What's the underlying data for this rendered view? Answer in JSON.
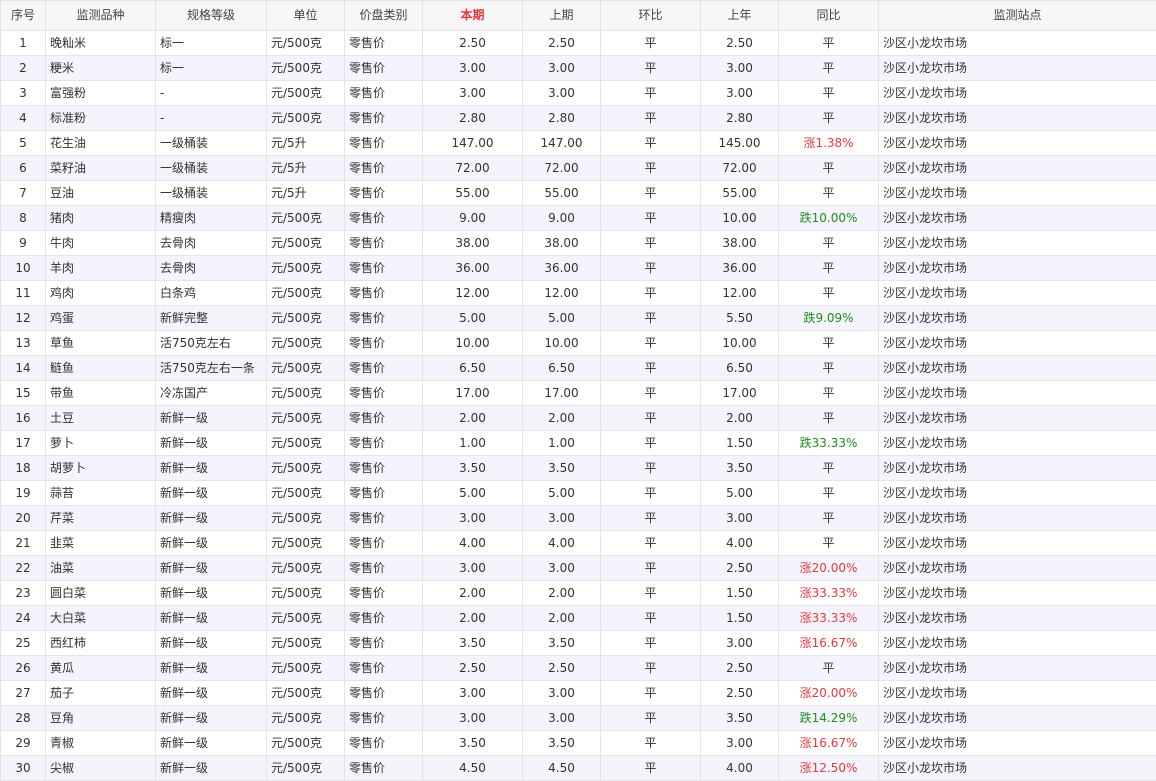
{
  "columns": [
    "序号",
    "监测品种",
    "规格等级",
    "单位",
    "价盘类别",
    "本期",
    "上期",
    "环比",
    "上年",
    "同比",
    "监测站点"
  ],
  "highlight_column": "本期",
  "colors": {
    "rise": "#e4393c",
    "fall": "#1e8f1e",
    "highlight_header": "#e4393c",
    "stripe": "#f5f3fc"
  },
  "rows": [
    [
      "1",
      "晚籼米",
      "标一",
      "元/500克",
      "零售价",
      "2.50",
      "2.50",
      "平",
      "2.50",
      "平",
      "沙区小龙坎市场"
    ],
    [
      "2",
      "粳米",
      "标一",
      "元/500克",
      "零售价",
      "3.00",
      "3.00",
      "平",
      "3.00",
      "平",
      "沙区小龙坎市场"
    ],
    [
      "3",
      "富强粉",
      "-",
      "元/500克",
      "零售价",
      "3.00",
      "3.00",
      "平",
      "3.00",
      "平",
      "沙区小龙坎市场"
    ],
    [
      "4",
      "标准粉",
      "-",
      "元/500克",
      "零售价",
      "2.80",
      "2.80",
      "平",
      "2.80",
      "平",
      "沙区小龙坎市场"
    ],
    [
      "5",
      "花生油",
      "一级桶装",
      "元/5升",
      "零售价",
      "147.00",
      "147.00",
      "平",
      "145.00",
      "涨1.38%",
      "沙区小龙坎市场"
    ],
    [
      "6",
      "菜籽油",
      "一级桶装",
      "元/5升",
      "零售价",
      "72.00",
      "72.00",
      "平",
      "72.00",
      "平",
      "沙区小龙坎市场"
    ],
    [
      "7",
      "豆油",
      "一级桶装",
      "元/5升",
      "零售价",
      "55.00",
      "55.00",
      "平",
      "55.00",
      "平",
      "沙区小龙坎市场"
    ],
    [
      "8",
      "猪肉",
      "精瘦肉",
      "元/500克",
      "零售价",
      "9.00",
      "9.00",
      "平",
      "10.00",
      "跌10.00%",
      "沙区小龙坎市场"
    ],
    [
      "9",
      "牛肉",
      "去骨肉",
      "元/500克",
      "零售价",
      "38.00",
      "38.00",
      "平",
      "38.00",
      "平",
      "沙区小龙坎市场"
    ],
    [
      "10",
      "羊肉",
      "去骨肉",
      "元/500克",
      "零售价",
      "36.00",
      "36.00",
      "平",
      "36.00",
      "平",
      "沙区小龙坎市场"
    ],
    [
      "11",
      "鸡肉",
      "白条鸡",
      "元/500克",
      "零售价",
      "12.00",
      "12.00",
      "平",
      "12.00",
      "平",
      "沙区小龙坎市场"
    ],
    [
      "12",
      "鸡蛋",
      "新鲜完整",
      "元/500克",
      "零售价",
      "5.00",
      "5.00",
      "平",
      "5.50",
      "跌9.09%",
      "沙区小龙坎市场"
    ],
    [
      "13",
      "草鱼",
      "活750克左右",
      "元/500克",
      "零售价",
      "10.00",
      "10.00",
      "平",
      "10.00",
      "平",
      "沙区小龙坎市场"
    ],
    [
      "14",
      "鲢鱼",
      "活750克左右一条",
      "元/500克",
      "零售价",
      "6.50",
      "6.50",
      "平",
      "6.50",
      "平",
      "沙区小龙坎市场"
    ],
    [
      "15",
      "带鱼",
      "冷冻国产",
      "元/500克",
      "零售价",
      "17.00",
      "17.00",
      "平",
      "17.00",
      "平",
      "沙区小龙坎市场"
    ],
    [
      "16",
      "土豆",
      "新鲜一级",
      "元/500克",
      "零售价",
      "2.00",
      "2.00",
      "平",
      "2.00",
      "平",
      "沙区小龙坎市场"
    ],
    [
      "17",
      "萝卜",
      "新鲜一级",
      "元/500克",
      "零售价",
      "1.00",
      "1.00",
      "平",
      "1.50",
      "跌33.33%",
      "沙区小龙坎市场"
    ],
    [
      "18",
      "胡萝卜",
      "新鲜一级",
      "元/500克",
      "零售价",
      "3.50",
      "3.50",
      "平",
      "3.50",
      "平",
      "沙区小龙坎市场"
    ],
    [
      "19",
      "蒜苔",
      "新鲜一级",
      "元/500克",
      "零售价",
      "5.00",
      "5.00",
      "平",
      "5.00",
      "平",
      "沙区小龙坎市场"
    ],
    [
      "20",
      "芹菜",
      "新鲜一级",
      "元/500克",
      "零售价",
      "3.00",
      "3.00",
      "平",
      "3.00",
      "平",
      "沙区小龙坎市场"
    ],
    [
      "21",
      "韭菜",
      "新鲜一级",
      "元/500克",
      "零售价",
      "4.00",
      "4.00",
      "平",
      "4.00",
      "平",
      "沙区小龙坎市场"
    ],
    [
      "22",
      "油菜",
      "新鲜一级",
      "元/500克",
      "零售价",
      "3.00",
      "3.00",
      "平",
      "2.50",
      "涨20.00%",
      "沙区小龙坎市场"
    ],
    [
      "23",
      "圆白菜",
      "新鲜一级",
      "元/500克",
      "零售价",
      "2.00",
      "2.00",
      "平",
      "1.50",
      "涨33.33%",
      "沙区小龙坎市场"
    ],
    [
      "24",
      "大白菜",
      "新鲜一级",
      "元/500克",
      "零售价",
      "2.00",
      "2.00",
      "平",
      "1.50",
      "涨33.33%",
      "沙区小龙坎市场"
    ],
    [
      "25",
      "西红柿",
      "新鲜一级",
      "元/500克",
      "零售价",
      "3.50",
      "3.50",
      "平",
      "3.00",
      "涨16.67%",
      "沙区小龙坎市场"
    ],
    [
      "26",
      "黄瓜",
      "新鲜一级",
      "元/500克",
      "零售价",
      "2.50",
      "2.50",
      "平",
      "2.50",
      "平",
      "沙区小龙坎市场"
    ],
    [
      "27",
      "茄子",
      "新鲜一级",
      "元/500克",
      "零售价",
      "3.00",
      "3.00",
      "平",
      "2.50",
      "涨20.00%",
      "沙区小龙坎市场"
    ],
    [
      "28",
      "豆角",
      "新鲜一级",
      "元/500克",
      "零售价",
      "3.00",
      "3.00",
      "平",
      "3.50",
      "跌14.29%",
      "沙区小龙坎市场"
    ],
    [
      "29",
      "青椒",
      "新鲜一级",
      "元/500克",
      "零售价",
      "3.50",
      "3.50",
      "平",
      "3.00",
      "涨16.67%",
      "沙区小龙坎市场"
    ],
    [
      "30",
      "尖椒",
      "新鲜一级",
      "元/500克",
      "零售价",
      "4.50",
      "4.50",
      "平",
      "4.00",
      "涨12.50%",
      "沙区小龙坎市场"
    ]
  ]
}
